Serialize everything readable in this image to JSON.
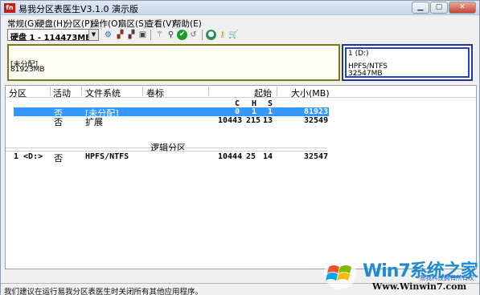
{
  "window": {
    "title": "易我分区表医生V3.1.0 演示版",
    "app_icon_text": "ㄅ",
    "controls": [
      "minimize",
      "maximize",
      "close"
    ]
  },
  "menu": [
    "常规(G)",
    "硬盘(H)",
    "分区(P)",
    "操作(O)",
    "扇区(S)",
    "查看(V)",
    "帮助(E)"
  ],
  "toolbar": {
    "disk_select": "硬盘 1 - 114473MB",
    "icons": [
      "analyze-icon",
      "reset-icon",
      "rebuild-icon",
      "copy-icon",
      "wand-icon",
      "magnify-icon",
      "check-icon",
      "undo-icon",
      "globe-icon",
      "key-icon",
      "cart-icon"
    ]
  },
  "diskmap": {
    "unallocated": {
      "label": "[未分配]",
      "size": "81923MB"
    },
    "ntfs": {
      "label": "1 (D:)",
      "fs": "HPFS/NTFS",
      "size": "32547MB"
    }
  },
  "table": {
    "headers": [
      "分区",
      "活动",
      "文件系统",
      "卷标",
      "起始",
      "大小(MB)"
    ],
    "subheaders": [
      "C",
      "H",
      "S"
    ],
    "primary_rows": [
      {
        "active": "否",
        "fs": "[未分配]",
        "c": "0",
        "h": "1",
        "s": "1",
        "size": "81923",
        "selected": true
      },
      {
        "active": "否",
        "fs": "扩展",
        "c": "10443",
        "h": "215",
        "s": "13",
        "size": "32549",
        "selected": false
      }
    ],
    "logical_group": "逻辑分区",
    "logical_rows": [
      {
        "part": "1 <D:>",
        "active": "否",
        "fs": "HPFS/NTFS",
        "c": "10444",
        "h": "25",
        "s": "14",
        "size": "32547"
      }
    ]
  },
  "status": "我们建议在运行易我分区表医生时关闭所有其他应用程序。",
  "corner_text": "易我科技拥有所有权",
  "watermark": {
    "title": "Win7系统之家",
    "url": "Www.Winwin7.com"
  }
}
